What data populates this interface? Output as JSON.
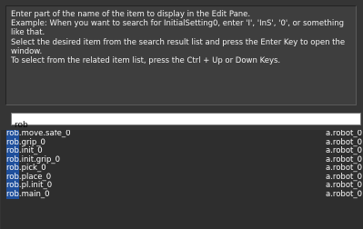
{
  "help_text": [
    "Enter part of the name of the item to display in the Edit Pane.",
    "Example: When you want to search for InitialSetting0, enter 'I', 'InS', '0', or something like that.",
    "Select the desired item from the search result list and press the Enter Key to open the window.",
    "To select from the related item list, press the Ctrl + Up or Down Keys."
  ],
  "search": {
    "value": "rob"
  },
  "results": [
    {
      "match": "rob",
      "rest": ".move.safe_0",
      "parent": "a.robot_0"
    },
    {
      "match": "rob",
      "rest": ".grip_0",
      "parent": "a.robot_0"
    },
    {
      "match": "rob",
      "rest": ".init_0",
      "parent": "a.robot_0"
    },
    {
      "match": "rob",
      "rest": ".init.grip_0",
      "parent": "a.robot_0"
    },
    {
      "match": "rob",
      "rest": ".pick_0",
      "parent": "a.robot_0"
    },
    {
      "match": "rob",
      "rest": ".place_0",
      "parent": "a.robot_0"
    },
    {
      "match": "rob",
      "rest": ".pl.init_0",
      "parent": "a.robot_0"
    },
    {
      "match": "rob",
      "rest": ".main_0",
      "parent": "a.robot_0"
    }
  ],
  "colors": {
    "background": "#353535",
    "help_panel": "#3e3e3e",
    "text": "#f2f2f2",
    "match_highlight": "#1e4f9c"
  }
}
